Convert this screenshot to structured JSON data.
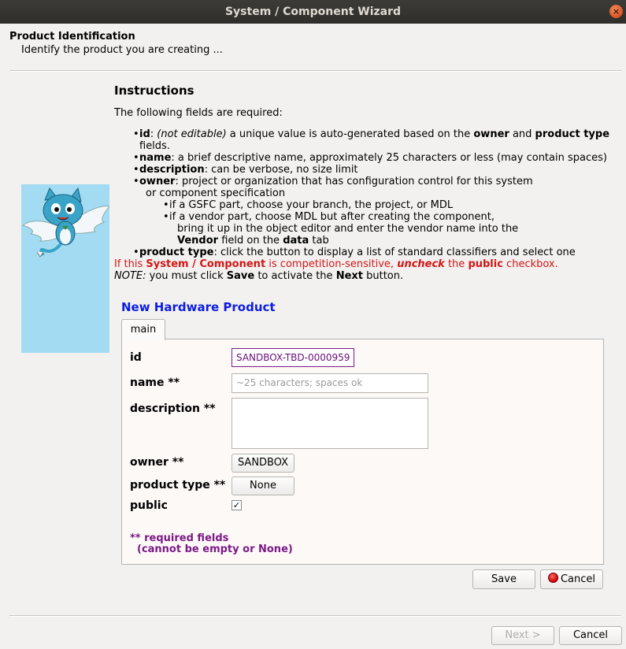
{
  "window": {
    "title": "System / Component Wizard",
    "close_glyph": "×"
  },
  "header": {
    "title": "Product Identification",
    "subtitle": "Identify the product you are creating ..."
  },
  "instructions": {
    "heading": "Instructions",
    "intro": "The following fields are required:",
    "id_term": "id",
    "id_note": "(not editable)",
    "id_text1": " a unique value is auto-generated based on the ",
    "id_owner": "owner",
    "id_and": " and ",
    "id_ptype": "product type",
    "id_end": " fields.",
    "name_term": "name",
    "name_text": ": a brief descriptive name, approximately 25 characters or less (may contain spaces)",
    "desc_term": "description",
    "desc_text": ": can be verbose, no size limit",
    "owner_term": "owner",
    "owner_text": ": project or organization that has configuration control for this system",
    "owner_cont": "or component specification",
    "gsfc_text": "if a GSFC part, choose your branch, the project, or MDL",
    "vendor_text1": "if a vendor part, choose MDL but after creating the component,",
    "vendor_text2": "bring it up in the object editor and enter the vendor name into the",
    "vendor_term": "Vendor",
    "vendor_text3": " field on the ",
    "vendor_data": "data",
    "vendor_tab": " tab",
    "ptype_term": "product type",
    "ptype_text": ": click the button to display a list of standard classifiers and select one",
    "red_1": "If this ",
    "red_sys": "System / Component",
    "red_2": " is competition-sensitive, ",
    "red_uncheck": "uncheck",
    "red_3": " the ",
    "red_public": "public",
    "red_4": " checkbox.",
    "note_label": "NOTE:",
    "note_1": " you must click ",
    "note_save": "Save",
    "note_2": " to activate the ",
    "note_next": "Next",
    "note_3": " button."
  },
  "form": {
    "title": "New Hardware Product",
    "tab": "main",
    "labels": {
      "id": "id",
      "name": "name **",
      "description": "description **",
      "owner": "owner **",
      "product_type": "product type **",
      "public": "public"
    },
    "id_value": "SANDBOX-TBD-0000959",
    "name_placeholder": "~25 characters; spaces ok",
    "description_value": "",
    "owner_button": "SANDBOX",
    "product_type_button": "None",
    "public_checked": true,
    "check_glyph": "✓",
    "required_note_1": "** required fields",
    "required_note_2": "(cannot be empty or None)",
    "save_button": "Save",
    "cancel_button": "Cancel"
  },
  "footer": {
    "next_button": "Next >",
    "cancel_button": "Cancel"
  },
  "colors": {
    "accent_blue": "#0d1de0",
    "required_purple": "#7a1a86",
    "warning_red": "#d41515",
    "mascot_bg": "#a3dcf2"
  }
}
